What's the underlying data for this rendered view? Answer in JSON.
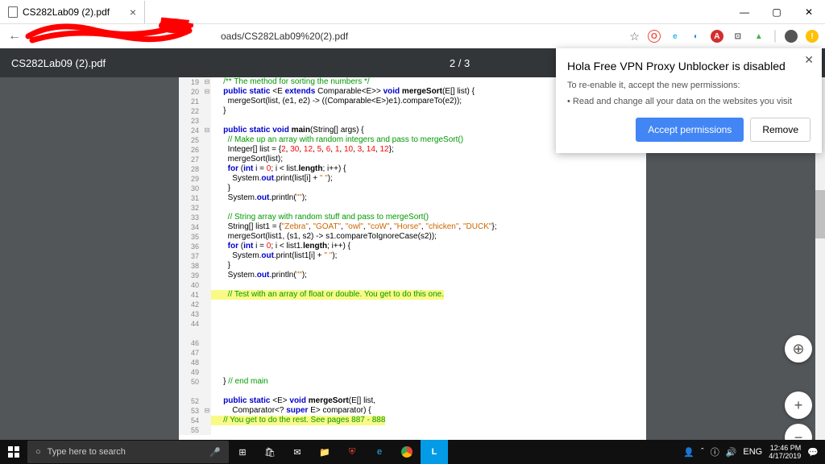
{
  "tab_title": "CS282Lab09 (2).pdf",
  "url_visible": "oads/CS282Lab09%20(2).pdf",
  "pdf_title": "CS282Lab09 (2).pdf",
  "page_indicator": "2 / 3",
  "popup": {
    "title": "Hola Free VPN Proxy Unblocker is disabled",
    "line1": "To re-enable it, accept the new permissions:",
    "line2": "• Read and change all your data on the websites you visit",
    "accept": "Accept permissions",
    "remove": "Remove"
  },
  "code": [
    {
      "n": 19,
      "f": "⊟",
      "t": "    /** The method for sorting the numbers */",
      "cls": "cm"
    },
    {
      "n": 20,
      "f": "⊟",
      "html": "    <span class='kw'>public static</span> &lt;E <span class='kw'>extends</span> Comparable&lt;E&gt;&gt; <span class='kw'>void</span> <b>mergeSort</b>(E[] list) {"
    },
    {
      "n": 21,
      "html": "      mergeSort(list, (e1, e2) -&gt; ((Comparable&lt;E&gt;)e1).compareTo(e2));"
    },
    {
      "n": 22,
      "t": "    }"
    },
    {
      "n": 23,
      "t": ""
    },
    {
      "n": 24,
      "f": "⊟",
      "html": "    <span class='kw'>public static void</span> <b>main</b>(String[] args) {"
    },
    {
      "n": 25,
      "html": "      <span class='cm'>// Make up an array with random integers and pass to mergeSort()</span>"
    },
    {
      "n": 26,
      "html": "      Integer[] list = {<span class='num'>2</span>, <span class='num'>30</span>, <span class='num'>12</span>, <span class='num'>5</span>, <span class='num'>6</span>, <span class='num'>1</span>, <span class='num'>10</span>, <span class='num'>3</span>, <span class='num'>14</span>, <span class='num'>12</span>};"
    },
    {
      "n": 27,
      "t": "      mergeSort(list);"
    },
    {
      "n": 28,
      "html": "      <span class='kw'>for</span> (<span class='kw'>int</span> i = <span class='num'>0</span>; i &lt; list.<b>length</b>; i++) {"
    },
    {
      "n": 29,
      "html": "        System.<span class='kw'>out</span>.print(list[i] + <span class='str'>\" \"</span>);"
    },
    {
      "n": 30,
      "t": "      }"
    },
    {
      "n": 31,
      "html": "      System.<span class='kw'>out</span>.println(<span class='str'>\"\"</span>);"
    },
    {
      "n": 32,
      "t": ""
    },
    {
      "n": 33,
      "html": "      <span class='cm'>// String array with random stuff and pass to mergeSort()</span>"
    },
    {
      "n": 34,
      "html": "      String[] list1 = {<span class='str'>\"Zebra\"</span>, <span class='str'>\"GOAT\"</span>, <span class='str'>\"owl\"</span>, <span class='str'>\"coW\"</span>, <span class='str'>\"Horse\"</span>, <span class='str'>\"chicken\"</span>, <span class='str'>\"DUCK\"</span>};"
    },
    {
      "n": 35,
      "html": "      mergeSort(list1, (s1, s2) -&gt; s1.compareToIgnoreCase(s2));"
    },
    {
      "n": 36,
      "html": "      <span class='kw'>for</span> (<span class='kw'>int</span> i = <span class='num'>0</span>; i &lt; list1.<b>length</b>; i++) {"
    },
    {
      "n": 37,
      "html": "        System.<span class='kw'>out</span>.print(list1[i] + <span class='str'>\" \"</span>);"
    },
    {
      "n": 38,
      "t": "      }"
    },
    {
      "n": 39,
      "html": "      System.<span class='kw'>out</span>.println(<span class='str'>\"\"</span>);"
    },
    {
      "n": 40,
      "t": ""
    },
    {
      "n": 41,
      "hl": true,
      "html": "      <span class='cm'>// Test with an array of float or double. You get to do this one.</span>"
    },
    {
      "n": 42,
      "t": ""
    },
    {
      "n": 43,
      "t": ""
    },
    {
      "n": 44,
      "t": ""
    },
    {
      "n": "",
      "t": ""
    },
    {
      "n": 46,
      "t": ""
    },
    {
      "n": 47,
      "t": ""
    },
    {
      "n": 48,
      "t": ""
    },
    {
      "n": 49,
      "t": ""
    },
    {
      "n": 50,
      "html": "    } <span class='cm'>// end main</span>"
    },
    {
      "n": "",
      "t": " "
    },
    {
      "n": 52,
      "html": "    <span class='kw'>public static</span> &lt;E&gt; <span class='kw'>void</span> <b>mergeSort</b>(E[] list,"
    },
    {
      "n": 53,
      "f": "⊟",
      "html": "        Comparator&lt;? <span class='kw'>super</span> E&gt; comparator) {"
    },
    {
      "n": 54,
      "hl": true,
      "html": "    <span class='cm'>// You get to do the rest. See pages 887 - 888</span>"
    },
    {
      "n": 55,
      "t": ""
    }
  ],
  "taskbar": {
    "search_placeholder": "Type here to search",
    "lang": "ENG",
    "time": "12:46 PM",
    "date": "4/17/2019"
  }
}
